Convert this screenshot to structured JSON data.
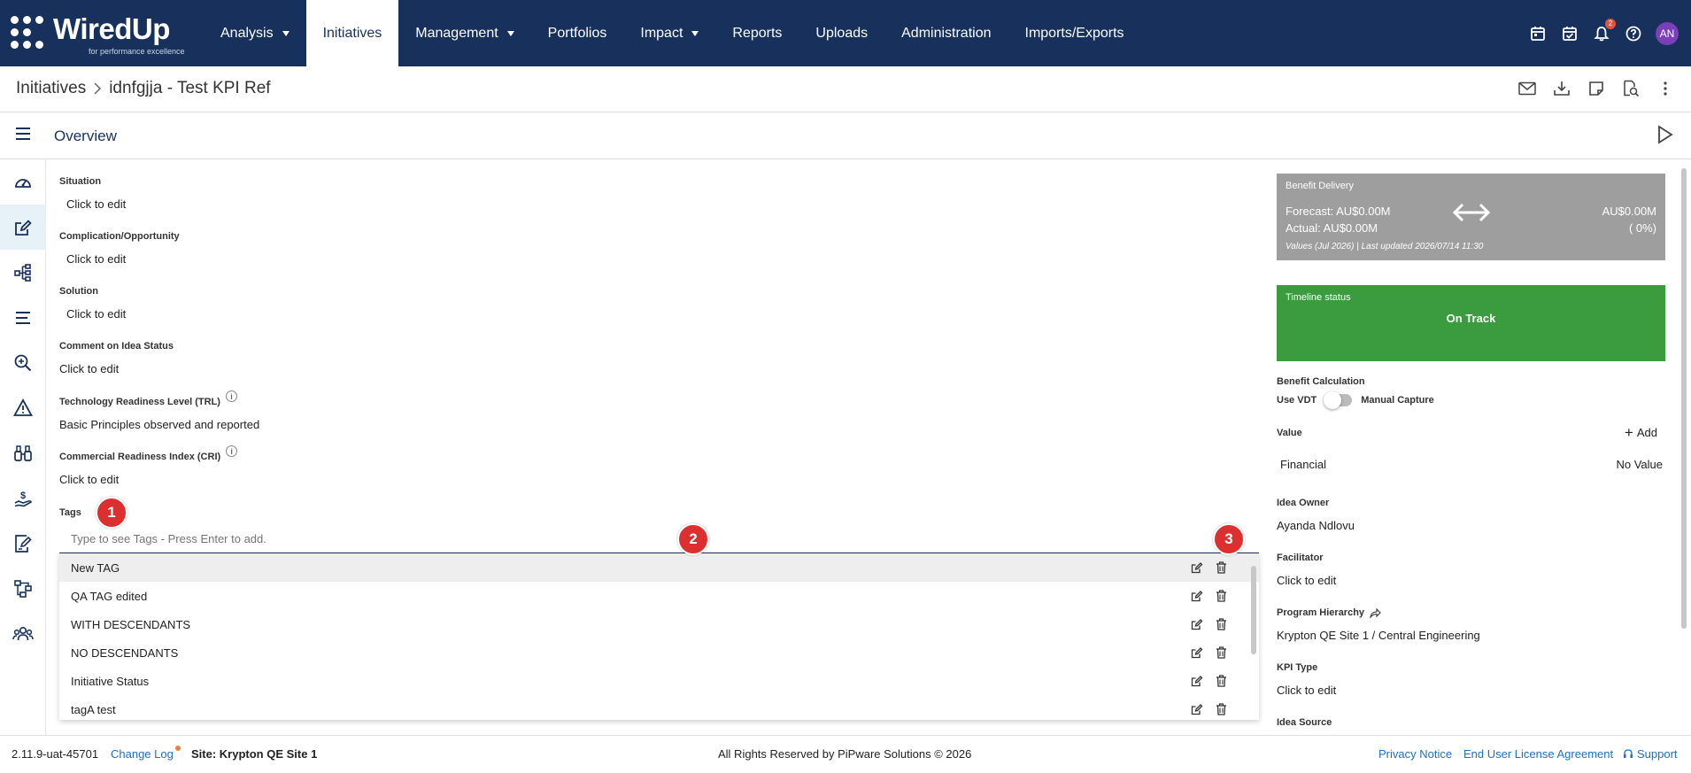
{
  "app": {
    "logo_name": "WiredUp",
    "logo_tagline": "for performance excellence"
  },
  "nav": {
    "items": [
      {
        "label": "Analysis",
        "dropdown": true
      },
      {
        "label": "Initiatives",
        "dropdown": false,
        "active": true
      },
      {
        "label": "Management",
        "dropdown": true
      },
      {
        "label": "Portfolios",
        "dropdown": false
      },
      {
        "label": "Impact",
        "dropdown": true
      },
      {
        "label": "Reports",
        "dropdown": false
      },
      {
        "label": "Uploads",
        "dropdown": false
      },
      {
        "label": "Administration",
        "dropdown": false
      },
      {
        "label": "Imports/Exports",
        "dropdown": false
      }
    ],
    "notification_count": "2",
    "avatar_initials": "AN",
    "icons": [
      "calendar-icon",
      "calendar-check-icon",
      "bell-icon",
      "help-icon"
    ]
  },
  "breadcrumb": {
    "root": "Initiatives",
    "current": "idnfgjja - Test KPI Ref"
  },
  "overview": {
    "title": "Overview"
  },
  "fields": {
    "situation": {
      "label": "Situation",
      "value": "Click to edit"
    },
    "complication": {
      "label": "Complication/Opportunity",
      "value": "Click to edit"
    },
    "solution": {
      "label": "Solution",
      "value": "Click to edit"
    },
    "comment": {
      "label": "Comment on Idea Status",
      "value": "Click to edit"
    },
    "trl": {
      "label": "Technology Readiness Level (TRL)",
      "value": "Basic Principles observed and reported"
    },
    "cri": {
      "label": "Commercial Readiness Index (CRI)",
      "value": "Click to edit"
    },
    "tags": {
      "label": "Tags",
      "placeholder": "Type to see Tags - Press Enter to add."
    }
  },
  "tag_options": [
    "New TAG",
    "QA TAG edited",
    "WITH DESCENDANTS",
    "NO DESCENDANTS",
    "Initiative Status",
    "tagA test"
  ],
  "markers": [
    "1",
    "2",
    "3"
  ],
  "benefit_delivery": {
    "title": "Benefit Delivery",
    "forecast": "Forecast: AU$0.00M",
    "actual": "Actual: AU$0.00M",
    "forecast_value": "AU$0.00M",
    "actual_value": "( 0%)",
    "values_note": "Values (Jul 2026) | Last updated 2026/07/14 11:30"
  },
  "timeline": {
    "title": "Timeline status",
    "status": "On Track"
  },
  "benefit_calculation": {
    "label": "Benefit Calculation",
    "left": "Use VDT",
    "right": "Manual Capture"
  },
  "value_section": {
    "label": "Value",
    "add": "Add",
    "row_label": "Financial",
    "row_value": "No Value"
  },
  "idea_owner": {
    "label": "Idea Owner",
    "value": "Ayanda Ndlovu"
  },
  "facilitator": {
    "label": "Facilitator",
    "value": "Click to edit"
  },
  "program_hierarchy": {
    "label": "Program Hierarchy",
    "value": "Krypton QE Site 1 / Central Engineering"
  },
  "kpi_type": {
    "label": "KPI Type",
    "value": "Click to edit"
  },
  "idea_source": {
    "label": "Idea Source"
  },
  "footer": {
    "version": "2.11.9-uat-45701",
    "changelog": "Change Log",
    "site": "Site: Krypton QE Site 1",
    "copyright": "All Rights Reserved by PiPware Solutions © 2026",
    "privacy": "Privacy Notice",
    "eula": "End User License Agreement",
    "support": "Support"
  },
  "colors": {
    "nav_bg": "#17315c",
    "marker": "#dc2f2f",
    "on_track": "#3a9b3f",
    "benefit_card": "#9e9e9e",
    "link": "#1f6fc5"
  }
}
